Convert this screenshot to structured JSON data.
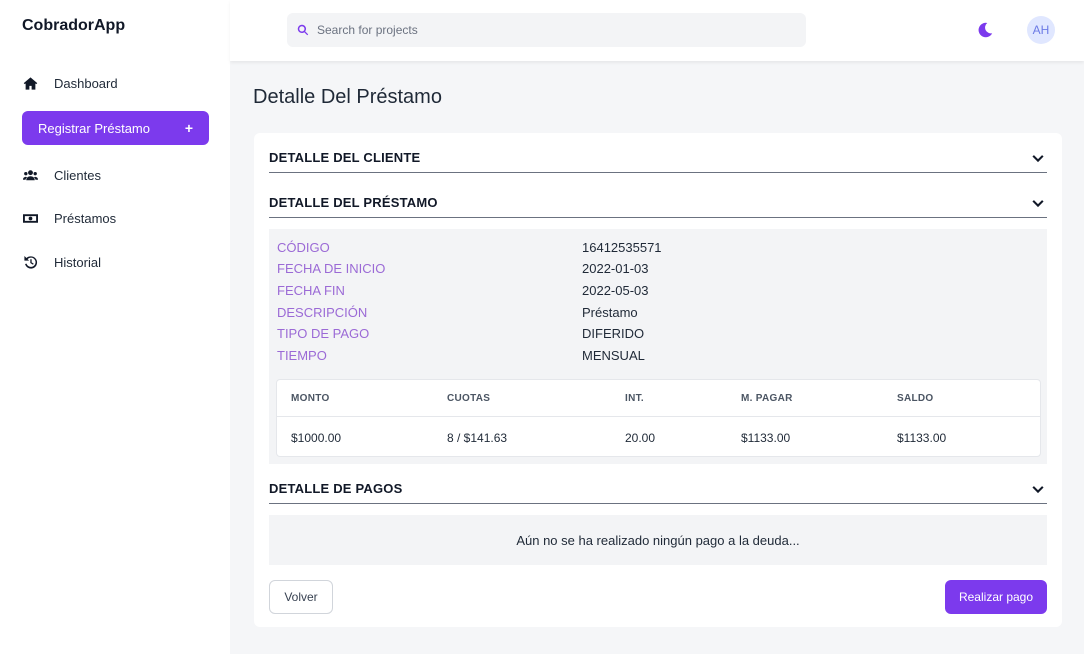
{
  "app": {
    "name": "CobradorApp"
  },
  "sidebar": {
    "items": [
      {
        "label": "Dashboard",
        "icon": "home-icon"
      },
      {
        "label": "Clientes",
        "icon": "users-icon"
      },
      {
        "label": "Préstamos",
        "icon": "money-bill-icon"
      },
      {
        "label": "Historial",
        "icon": "history-icon"
      }
    ],
    "register_button": {
      "label": "Registrar Préstamo",
      "icon": "+"
    }
  },
  "header": {
    "search": {
      "placeholder": "Search for projects"
    },
    "avatar_initials": "AH",
    "theme_icon": "moon-icon"
  },
  "page": {
    "title": "Detalle Del Préstamo"
  },
  "sections": {
    "cliente": {
      "title": "DETALLE DEL CLIENTE"
    },
    "prestamo": {
      "title": "DETALLE DEL PRÉSTAMO",
      "fields": [
        {
          "key": "CÓDIGO",
          "value": "16412535571"
        },
        {
          "key": "FECHA DE INICIO",
          "value": "2022-01-03"
        },
        {
          "key": "FECHA FIN",
          "value": "2022-05-03"
        },
        {
          "key": "DESCRIPCIÓN",
          "value": "Préstamo"
        },
        {
          "key": "TIPO DE PAGO",
          "value": "DIFERIDO"
        },
        {
          "key": "TIEMPO",
          "value": "MENSUAL"
        }
      ],
      "table": {
        "headers": [
          "MONTO",
          "CUOTAS",
          "INT.",
          "M. PAGAR",
          "SALDO"
        ],
        "rows": [
          [
            "$1000.00",
            "8 / $141.63",
            "20.00",
            "$1133.00",
            "$1133.00"
          ]
        ]
      }
    },
    "pagos": {
      "title": "DETALLE DE PAGOS",
      "empty_message": "Aún no se ha realizado ningún pago a la deuda..."
    }
  },
  "actions": {
    "back_label": "Volver",
    "pay_label": "Realizar pago"
  },
  "colors": {
    "accent": "#7c3aed",
    "label_purple": "#9b6ad6",
    "panel_bg": "#f3f4f6"
  }
}
